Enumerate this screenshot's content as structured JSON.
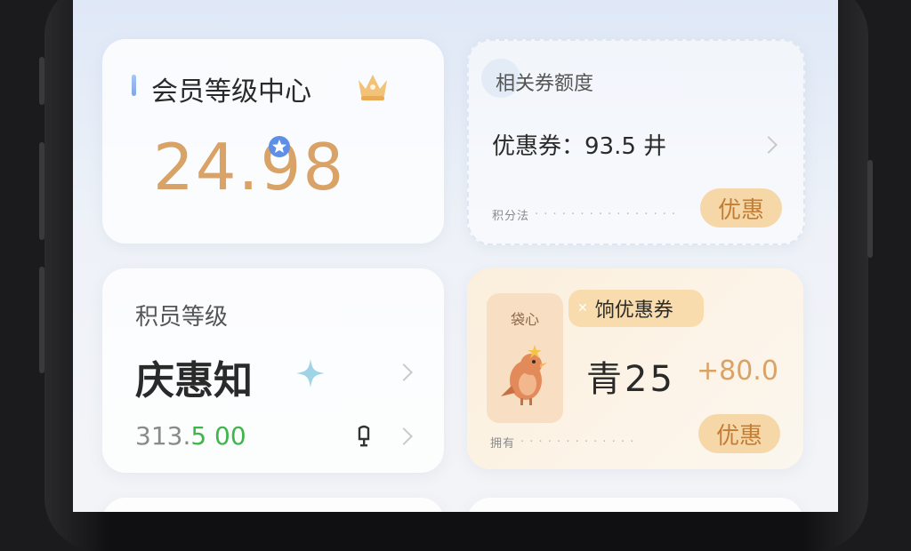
{
  "member_card": {
    "title": "会员等级中心",
    "value": "24.98"
  },
  "discount_card": {
    "header": "相关券额度",
    "coupon_text": "优惠券：93.5 井",
    "footnote": "积分法",
    "button_label": "优惠"
  },
  "level_card": {
    "label": "积员等级",
    "level_name": "庆惠知",
    "points_gray": "313.",
    "points_green": "5 00"
  },
  "coupon_card": {
    "mascot_label": "袋心",
    "tag_label": "饷优惠券",
    "value": "青25",
    "bonus": "+80.0",
    "footnote": "拥有",
    "button_label": "优惠"
  },
  "colors": {
    "accent_orange": "#d9a266",
    "pill_bg": "#f6d8a8",
    "pill_text": "#c27d37",
    "green": "#3fb54b",
    "sparkle": "#9fd3e6"
  },
  "icons": [
    "crown-icon",
    "star-badge-icon",
    "sparkle-icon",
    "bell-icon",
    "chevron-right-icon",
    "mascot-bird-icon"
  ]
}
